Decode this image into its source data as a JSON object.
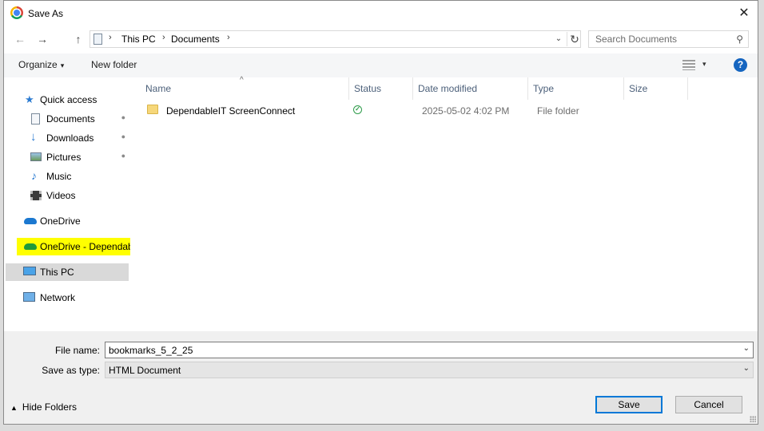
{
  "window": {
    "title": "Save As",
    "close_glyph": "✕"
  },
  "address": {
    "back_glyph": "←",
    "forward_glyph": "→",
    "up_glyph": "↑",
    "crumbs": [
      "This PC",
      "Documents"
    ],
    "separator": "›",
    "dropdown_glyph": "⌄",
    "refresh_glyph": "↻"
  },
  "search": {
    "placeholder": "Search Documents",
    "icon": "⚲"
  },
  "toolbar": {
    "organize_label": "Organize",
    "new_folder_label": "New folder",
    "help_glyph": "?",
    "caret": "▾"
  },
  "navpane": {
    "items": [
      {
        "label": "Quick access",
        "icon": "star-icon",
        "pinned": false
      },
      {
        "label": "Documents",
        "icon": "documents-icon",
        "pinned": true
      },
      {
        "label": "Downloads",
        "icon": "downloads-icon",
        "pinned": true
      },
      {
        "label": "Pictures",
        "icon": "pictures-icon",
        "pinned": true
      },
      {
        "label": "Music",
        "icon": "music-icon",
        "pinned": false
      },
      {
        "label": "Videos",
        "icon": "videos-icon",
        "pinned": false
      },
      {
        "label": "OneDrive",
        "icon": "onedrive-icon",
        "pinned": false
      },
      {
        "label": "OneDrive - Dependab",
        "icon": "onedrive-business-icon",
        "pinned": false,
        "highlighted": true
      },
      {
        "label": "This PC",
        "icon": "this-pc-icon",
        "pinned": false,
        "selected": true
      },
      {
        "label": "Network",
        "icon": "network-icon",
        "pinned": false
      }
    ],
    "pin_glyph": "📌"
  },
  "filelist": {
    "sort_glyph": "^",
    "columns": [
      "Name",
      "Status",
      "Date modified",
      "Type",
      "Size"
    ],
    "rows": [
      {
        "name": "DependableIT ScreenConnect",
        "status": "synced",
        "date_modified": "2025-05-02 4:02 PM",
        "type": "File folder",
        "size": ""
      }
    ]
  },
  "footer": {
    "file_name_label": "File name:",
    "file_name_value": "bookmarks_5_2_25",
    "save_type_label": "Save as type:",
    "save_type_value": "HTML Document",
    "hide_folders_label": "Hide Folders",
    "save_label": "Save",
    "cancel_label": "Cancel"
  },
  "colors": {
    "accent": "#0078d7",
    "highlight": "#ffff00",
    "selected_bg": "#d9d9d9",
    "help": "#1565c0",
    "status_ok": "#2e9c4a"
  }
}
